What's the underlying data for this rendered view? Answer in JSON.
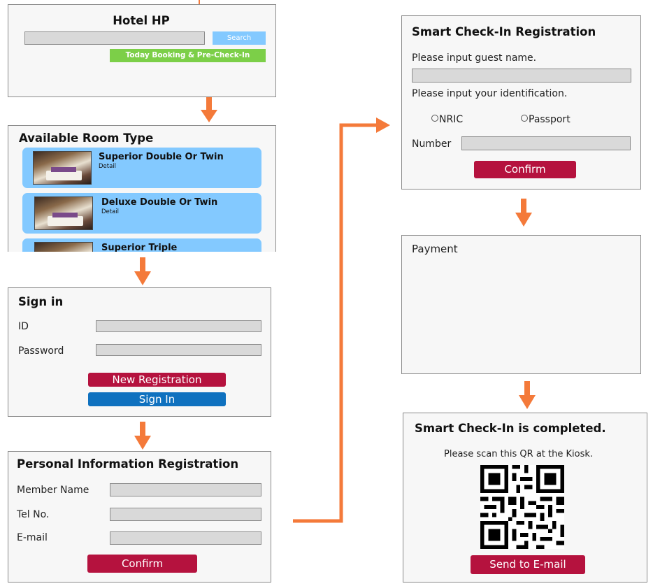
{
  "hotel_hp": {
    "title": "Hotel HP",
    "search_label": "Search",
    "booking_label": "Today Booking & Pre-Check-In"
  },
  "rooms": {
    "title": "Available Room Type",
    "items": [
      {
        "name": "Superior Double Or Twin",
        "detail": "Detail"
      },
      {
        "name": "Deluxe Double Or Twin",
        "detail": "Detail"
      },
      {
        "name": "Superior Triple",
        "detail": ""
      }
    ]
  },
  "sign_in": {
    "title": "Sign in",
    "id_label": "ID",
    "password_label": "Password",
    "new_registration_label": "New Registration",
    "sign_in_label": "Sign In"
  },
  "personal": {
    "title": "Personal Information Registration",
    "member_name_label": "Member Name",
    "tel_label": "Tel No.",
    "email_label": "E-mail",
    "confirm_label": "Confirm"
  },
  "checkin": {
    "title": "Smart Check-In Registration",
    "guest_prompt": "Please input guest name.",
    "id_prompt": "Please input your identification.",
    "nric_label": "NRIC",
    "passport_label": "Passport",
    "number_label": "Number",
    "confirm_label": "Confirm"
  },
  "payment": {
    "title": "Payment"
  },
  "completed": {
    "title": "Smart Check-In is completed.",
    "instruction": "Please scan this QR at the Kiosk.",
    "send_label": "Send to E-mail"
  },
  "colors": {
    "arrow": "#f47a3a",
    "button_red": "#b5123e",
    "button_blue": "#0f71bf",
    "search_blue": "#83c9ff",
    "booking_green": "#7ccf48",
    "room_card": "#83c9ff"
  }
}
